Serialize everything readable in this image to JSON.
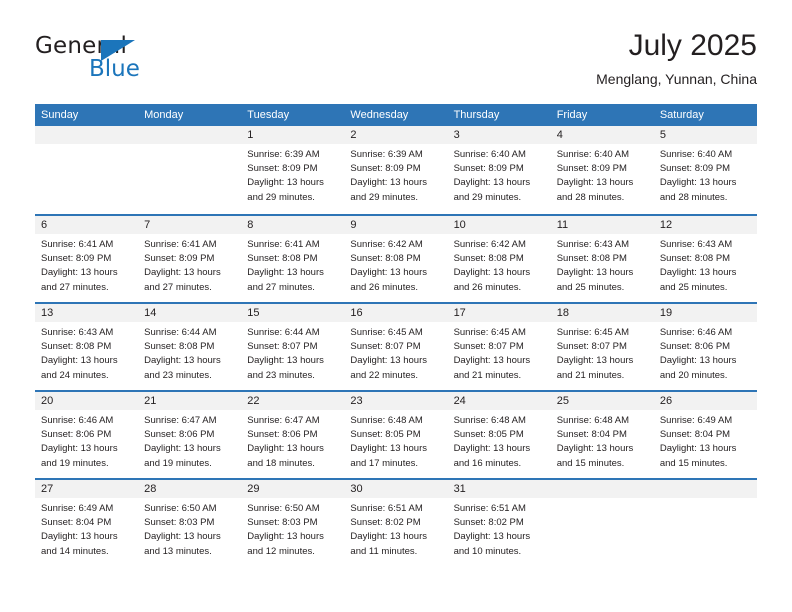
{
  "brand": {
    "name_top": "General",
    "name_bottom": "Blue",
    "accent_color": "#1b75bb"
  },
  "header": {
    "title": "July 2025",
    "subtitle": "Menglang, Yunnan, China"
  },
  "theme": {
    "header_blue": "#2e75b6",
    "day_band_gray": "#f2f2f2",
    "text_color": "#231f20"
  },
  "weekdays": [
    "Sunday",
    "Monday",
    "Tuesday",
    "Wednesday",
    "Thursday",
    "Friday",
    "Saturday"
  ],
  "weeks": [
    [
      {
        "day": "",
        "lines": []
      },
      {
        "day": "",
        "lines": []
      },
      {
        "day": "1",
        "lines": [
          "Sunrise: 6:39 AM",
          "Sunset: 8:09 PM",
          "Daylight: 13 hours",
          "and 29 minutes."
        ]
      },
      {
        "day": "2",
        "lines": [
          "Sunrise: 6:39 AM",
          "Sunset: 8:09 PM",
          "Daylight: 13 hours",
          "and 29 minutes."
        ]
      },
      {
        "day": "3",
        "lines": [
          "Sunrise: 6:40 AM",
          "Sunset: 8:09 PM",
          "Daylight: 13 hours",
          "and 29 minutes."
        ]
      },
      {
        "day": "4",
        "lines": [
          "Sunrise: 6:40 AM",
          "Sunset: 8:09 PM",
          "Daylight: 13 hours",
          "and 28 minutes."
        ]
      },
      {
        "day": "5",
        "lines": [
          "Sunrise: 6:40 AM",
          "Sunset: 8:09 PM",
          "Daylight: 13 hours",
          "and 28 minutes."
        ]
      }
    ],
    [
      {
        "day": "6",
        "lines": [
          "Sunrise: 6:41 AM",
          "Sunset: 8:09 PM",
          "Daylight: 13 hours",
          "and 27 minutes."
        ]
      },
      {
        "day": "7",
        "lines": [
          "Sunrise: 6:41 AM",
          "Sunset: 8:09 PM",
          "Daylight: 13 hours",
          "and 27 minutes."
        ]
      },
      {
        "day": "8",
        "lines": [
          "Sunrise: 6:41 AM",
          "Sunset: 8:08 PM",
          "Daylight: 13 hours",
          "and 27 minutes."
        ]
      },
      {
        "day": "9",
        "lines": [
          "Sunrise: 6:42 AM",
          "Sunset: 8:08 PM",
          "Daylight: 13 hours",
          "and 26 minutes."
        ]
      },
      {
        "day": "10",
        "lines": [
          "Sunrise: 6:42 AM",
          "Sunset: 8:08 PM",
          "Daylight: 13 hours",
          "and 26 minutes."
        ]
      },
      {
        "day": "11",
        "lines": [
          "Sunrise: 6:43 AM",
          "Sunset: 8:08 PM",
          "Daylight: 13 hours",
          "and 25 minutes."
        ]
      },
      {
        "day": "12",
        "lines": [
          "Sunrise: 6:43 AM",
          "Sunset: 8:08 PM",
          "Daylight: 13 hours",
          "and 25 minutes."
        ]
      }
    ],
    [
      {
        "day": "13",
        "lines": [
          "Sunrise: 6:43 AM",
          "Sunset: 8:08 PM",
          "Daylight: 13 hours",
          "and 24 minutes."
        ]
      },
      {
        "day": "14",
        "lines": [
          "Sunrise: 6:44 AM",
          "Sunset: 8:08 PM",
          "Daylight: 13 hours",
          "and 23 minutes."
        ]
      },
      {
        "day": "15",
        "lines": [
          "Sunrise: 6:44 AM",
          "Sunset: 8:07 PM",
          "Daylight: 13 hours",
          "and 23 minutes."
        ]
      },
      {
        "day": "16",
        "lines": [
          "Sunrise: 6:45 AM",
          "Sunset: 8:07 PM",
          "Daylight: 13 hours",
          "and 22 minutes."
        ]
      },
      {
        "day": "17",
        "lines": [
          "Sunrise: 6:45 AM",
          "Sunset: 8:07 PM",
          "Daylight: 13 hours",
          "and 21 minutes."
        ]
      },
      {
        "day": "18",
        "lines": [
          "Sunrise: 6:45 AM",
          "Sunset: 8:07 PM",
          "Daylight: 13 hours",
          "and 21 minutes."
        ]
      },
      {
        "day": "19",
        "lines": [
          "Sunrise: 6:46 AM",
          "Sunset: 8:06 PM",
          "Daylight: 13 hours",
          "and 20 minutes."
        ]
      }
    ],
    [
      {
        "day": "20",
        "lines": [
          "Sunrise: 6:46 AM",
          "Sunset: 8:06 PM",
          "Daylight: 13 hours",
          "and 19 minutes."
        ]
      },
      {
        "day": "21",
        "lines": [
          "Sunrise: 6:47 AM",
          "Sunset: 8:06 PM",
          "Daylight: 13 hours",
          "and 19 minutes."
        ]
      },
      {
        "day": "22",
        "lines": [
          "Sunrise: 6:47 AM",
          "Sunset: 8:06 PM",
          "Daylight: 13 hours",
          "and 18 minutes."
        ]
      },
      {
        "day": "23",
        "lines": [
          "Sunrise: 6:48 AM",
          "Sunset: 8:05 PM",
          "Daylight: 13 hours",
          "and 17 minutes."
        ]
      },
      {
        "day": "24",
        "lines": [
          "Sunrise: 6:48 AM",
          "Sunset: 8:05 PM",
          "Daylight: 13 hours",
          "and 16 minutes."
        ]
      },
      {
        "day": "25",
        "lines": [
          "Sunrise: 6:48 AM",
          "Sunset: 8:04 PM",
          "Daylight: 13 hours",
          "and 15 minutes."
        ]
      },
      {
        "day": "26",
        "lines": [
          "Sunrise: 6:49 AM",
          "Sunset: 8:04 PM",
          "Daylight: 13 hours",
          "and 15 minutes."
        ]
      }
    ],
    [
      {
        "day": "27",
        "lines": [
          "Sunrise: 6:49 AM",
          "Sunset: 8:04 PM",
          "Daylight: 13 hours",
          "and 14 minutes."
        ]
      },
      {
        "day": "28",
        "lines": [
          "Sunrise: 6:50 AM",
          "Sunset: 8:03 PM",
          "Daylight: 13 hours",
          "and 13 minutes."
        ]
      },
      {
        "day": "29",
        "lines": [
          "Sunrise: 6:50 AM",
          "Sunset: 8:03 PM",
          "Daylight: 13 hours",
          "and 12 minutes."
        ]
      },
      {
        "day": "30",
        "lines": [
          "Sunrise: 6:51 AM",
          "Sunset: 8:02 PM",
          "Daylight: 13 hours",
          "and 11 minutes."
        ]
      },
      {
        "day": "31",
        "lines": [
          "Sunrise: 6:51 AM",
          "Sunset: 8:02 PM",
          "Daylight: 13 hours",
          "and 10 minutes."
        ]
      },
      {
        "day": "",
        "lines": []
      },
      {
        "day": "",
        "lines": []
      }
    ]
  ]
}
